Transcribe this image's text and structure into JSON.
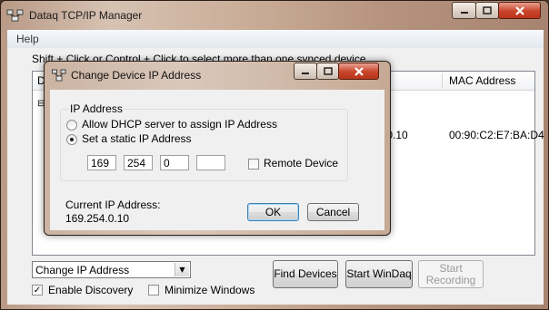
{
  "main_window": {
    "title": "Dataq TCP/IP Manager",
    "menu": [
      "Help"
    ],
    "instructions": "Shift + Click or Control + Click to select more than one synced device",
    "list": {
      "columns": [
        "D",
        "ss",
        "MAC Address"
      ],
      "rows": [
        {
          "col0": "⊟",
          "ip": ".0.10",
          "mac": "00:90:C2:E7:BA:D4"
        }
      ]
    },
    "action_select": {
      "value": "Change IP Address"
    },
    "buttons": {
      "find_devices": "Find Devices",
      "start_windaq": "Start WinDaq",
      "start_recording": "Start\nRecording"
    },
    "enable_discovery": {
      "label": "Enable Discovery",
      "checked": true
    },
    "minimize_windows": {
      "label": "Minimize Windows",
      "checked": false
    }
  },
  "dialog": {
    "title": "Change Device IP Address",
    "group_title": "IP Address",
    "radio_dhcp": {
      "label": "Allow DHCP server to assign IP Address",
      "checked": false
    },
    "radio_static": {
      "label": "Set a static IP Address",
      "checked": true
    },
    "ip_octets": [
      "169",
      "254",
      "0",
      ""
    ],
    "remote_device": {
      "label": "Remote Device",
      "checked": false
    },
    "current_ip_label": "Current IP Address:",
    "current_ip_value": "169.254.0.10",
    "ok_label": "OK",
    "cancel_label": "Cancel"
  },
  "icons": {
    "window_controls": [
      "minimize-icon",
      "maximize-icon",
      "close-icon"
    ],
    "app": "network-icon"
  },
  "colors": {
    "close_button": "#c8442a",
    "menubar": "#e3e8ef",
    "client": "#f0f0f0"
  }
}
